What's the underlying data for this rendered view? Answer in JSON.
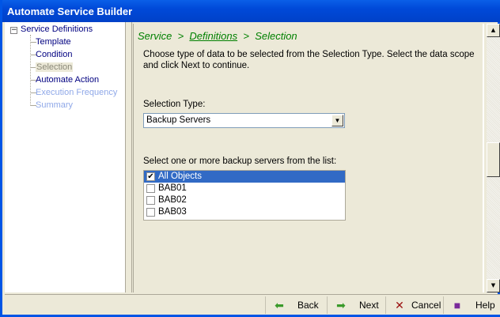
{
  "window": {
    "title": "Automate Service Builder"
  },
  "tree": {
    "root": "Service Definitions",
    "expander": "−",
    "items": [
      {
        "label": "Template",
        "state": "enabled"
      },
      {
        "label": "Condition",
        "state": "enabled"
      },
      {
        "label": "Selection",
        "state": "current"
      },
      {
        "label": "Automate Action",
        "state": "enabled"
      },
      {
        "label": "Execution Frequency",
        "state": "disabled"
      },
      {
        "label": "Summary",
        "state": "disabled"
      }
    ]
  },
  "breadcrumb": {
    "part1": "Service",
    "sep1": ">",
    "part2": "Definitions",
    "sep2": ">",
    "part3": "Selection"
  },
  "instructions": "Choose type of data to be selected from the Selection Type. Select the data scope and click Next to continue.",
  "selection_type": {
    "label": "Selection Type:",
    "value": "Backup Servers"
  },
  "server_list": {
    "label": "Select one or more backup servers from the list:",
    "items": [
      {
        "label": "All Objects",
        "checked": true,
        "selected": true
      },
      {
        "label": "BAB01",
        "checked": false
      },
      {
        "label": "BAB02",
        "checked": false
      },
      {
        "label": "BAB03",
        "checked": false
      }
    ]
  },
  "buttons": {
    "back": "Back",
    "next": "Next",
    "cancel": "Cancel",
    "help": "Help"
  },
  "colors": {
    "accent": "#316ac5",
    "breadcrumb": "#008000",
    "enabled": "#000080",
    "disabled": "#8fa8e8"
  }
}
